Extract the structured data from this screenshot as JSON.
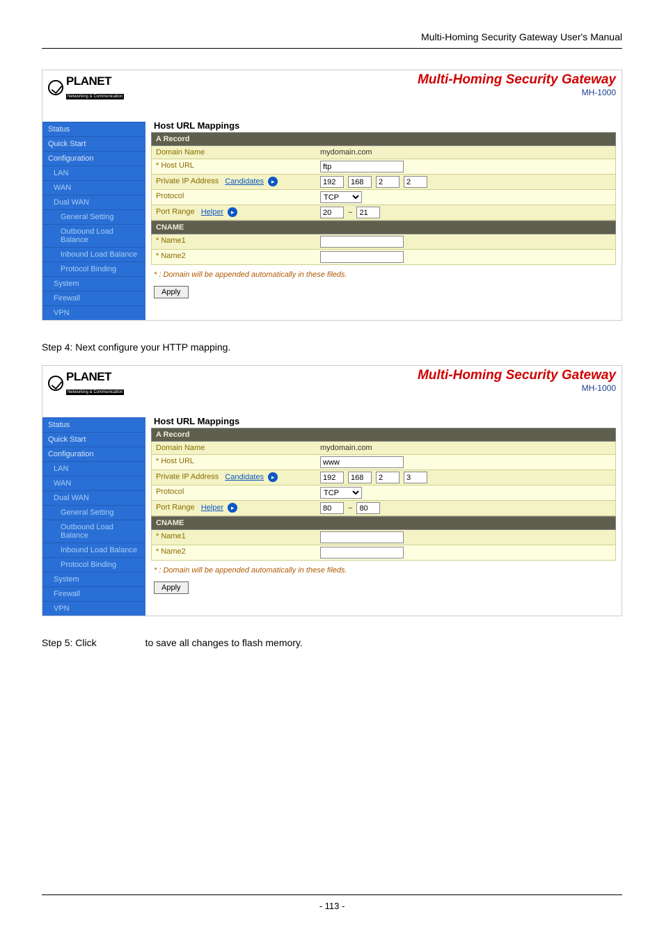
{
  "doc_header": {
    "title": "Multi-Homing  Security  Gateway  User's  Manual"
  },
  "logo": {
    "brand": "PLANET",
    "tagline": "Networking & Communication"
  },
  "app_header": {
    "title": "Multi-Homing Security Gateway",
    "model": "MH-1000"
  },
  "sidebar": {
    "items": [
      {
        "label": "Status",
        "indent": 0
      },
      {
        "label": "Quick Start",
        "indent": 0
      },
      {
        "label": "Configuration",
        "indent": 0
      },
      {
        "label": "LAN",
        "indent": 1
      },
      {
        "label": "WAN",
        "indent": 1
      },
      {
        "label": "Dual WAN",
        "indent": 1
      },
      {
        "label": "General Setting",
        "indent": 2
      },
      {
        "label": "Outbound Load Balance",
        "indent": 2
      },
      {
        "label": "Inbound Load Balance",
        "indent": 2
      },
      {
        "label": "Protocol Binding",
        "indent": 2
      },
      {
        "label": "System",
        "indent": 1
      },
      {
        "label": "Firewall",
        "indent": 1
      },
      {
        "label": "VPN",
        "indent": 1
      }
    ]
  },
  "panel1": {
    "section_title": "Host URL Mappings",
    "a_record_bar": "A Record",
    "domain_name_label": "Domain Name",
    "domain_name_value": "mydomain.com",
    "host_url_label": "* Host URL",
    "host_url_value": "ftp",
    "private_ip_label": "Private IP Address",
    "candidates_label": "Candidates",
    "ip_octets": [
      "192",
      "168",
      "2",
      "2"
    ],
    "protocol_label": "Protocol",
    "protocol_value": "TCP",
    "port_range_label": "Port Range",
    "helper_label": "Helper",
    "port_from": "20",
    "port_to": "21",
    "cname_bar": "CNAME",
    "name1_label": "* Name1",
    "name1_value": "",
    "name2_label": "* Name2",
    "name2_value": "",
    "note": "* : Domain will be appended automatically in these fileds.",
    "apply": "Apply"
  },
  "step4": {
    "text": "Step 4: Next configure your HTTP mapping."
  },
  "panel2": {
    "section_title": "Host URL Mappings",
    "a_record_bar": "A Record",
    "domain_name_label": "Domain Name",
    "domain_name_value": "mydomain.com",
    "host_url_label": "* Host URL",
    "host_url_value": "www",
    "private_ip_label": "Private IP Address",
    "candidates_label": "Candidates",
    "ip_octets": [
      "192",
      "168",
      "2",
      "3"
    ],
    "protocol_label": "Protocol",
    "protocol_value": "TCP",
    "port_range_label": "Port Range",
    "helper_label": "Helper",
    "port_from": "80",
    "port_to": "80",
    "cname_bar": "CNAME",
    "name1_label": "* Name1",
    "name1_value": "",
    "name2_label": "* Name2",
    "name2_value": "",
    "note": "* : Domain will be appended automatically in these fileds.",
    "apply": "Apply"
  },
  "step5": {
    "left": "Step 5: Click",
    "right": "to save all changes to flash memory."
  },
  "footer": {
    "page": "- 113 -"
  }
}
